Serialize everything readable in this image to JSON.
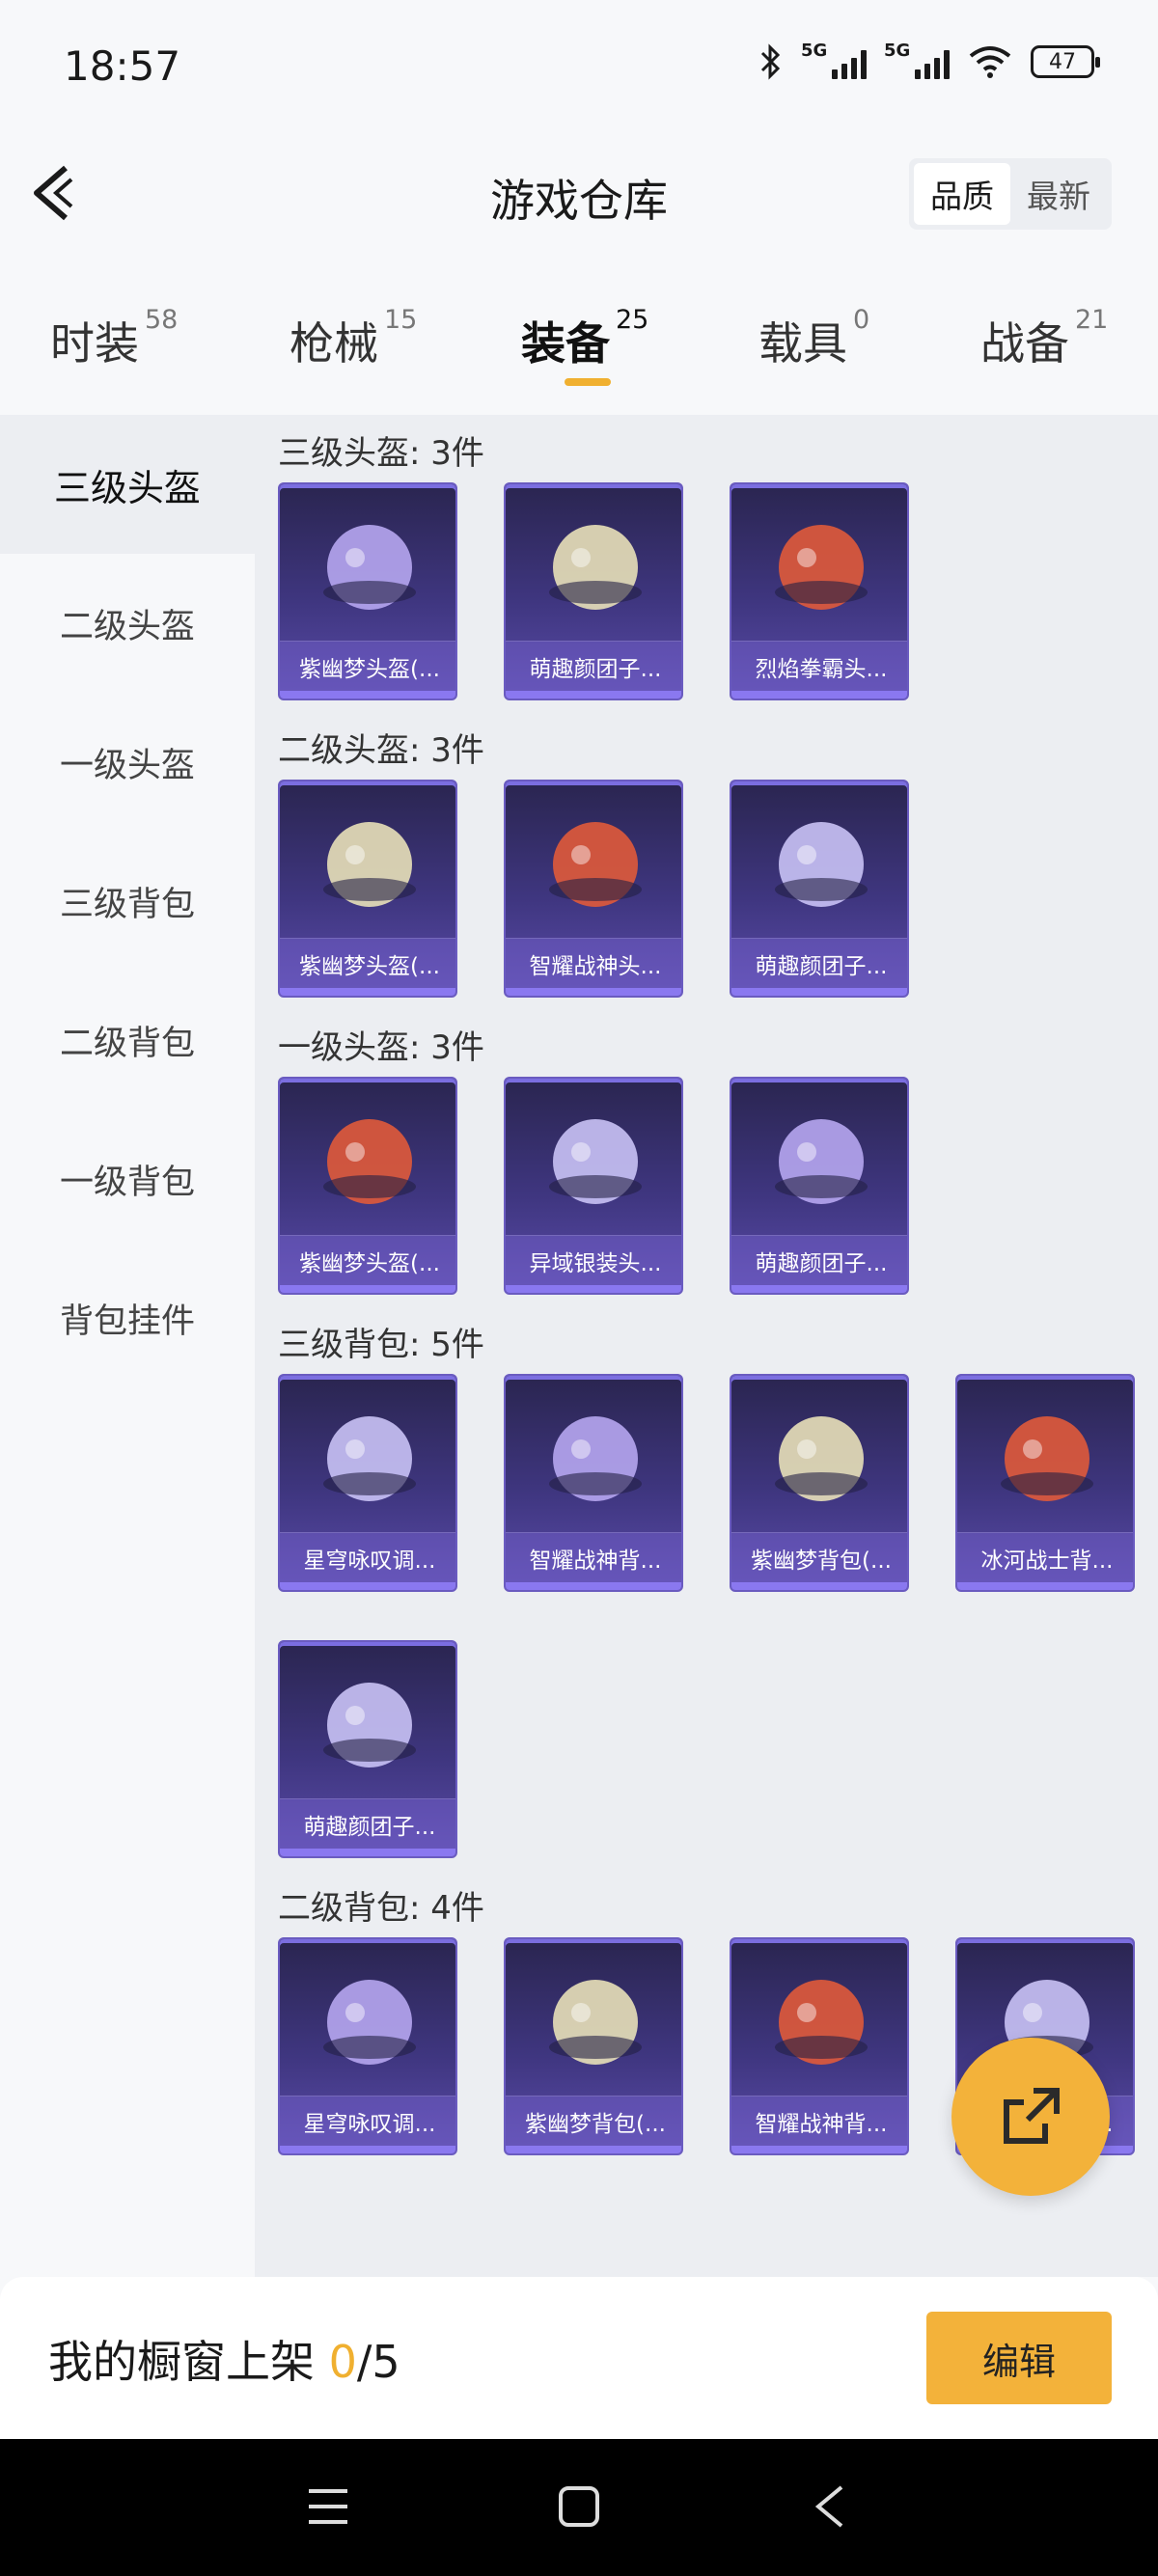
{
  "status": {
    "time": "18:57",
    "network1": "5G",
    "network2": "5G",
    "battery": "47"
  },
  "header": {
    "title": "游戏仓库",
    "sort_options": [
      "品质",
      "最新"
    ],
    "sort_active": "品质"
  },
  "tabs": [
    {
      "label": "时装",
      "count": "58"
    },
    {
      "label": "枪械",
      "count": "15"
    },
    {
      "label": "装备",
      "count": "25"
    },
    {
      "label": "载具",
      "count": "0"
    },
    {
      "label": "战备",
      "count": "21"
    }
  ],
  "active_tab": "装备",
  "sidebar": {
    "items": [
      "三级头盔",
      "二级头盔",
      "一级头盔",
      "三级背包",
      "二级背包",
      "一级背包",
      "背包挂件"
    ],
    "active": "三级头盔"
  },
  "sections": [
    {
      "title": "三级头盔: 3件",
      "items": [
        "紫幽梦头盔(...",
        "萌趣颜团子...",
        "烈焰拳霸头..."
      ]
    },
    {
      "title": "二级头盔: 3件",
      "items": [
        "紫幽梦头盔(...",
        "智耀战神头...",
        "萌趣颜团子..."
      ]
    },
    {
      "title": "一级头盔: 3件",
      "items": [
        "紫幽梦头盔(...",
        "异域银装头...",
        "萌趣颜团子..."
      ]
    },
    {
      "title": "三级背包: 5件",
      "items": [
        "星穹咏叹调...",
        "智耀战神背...",
        "紫幽梦背包(...",
        "冰河战士背...",
        "萌趣颜团子..."
      ]
    },
    {
      "title": "二级背包: 4件",
      "items": [
        "星穹咏叹调...",
        "紫幽梦背包(...",
        "智耀战神背...",
        "萌趣颜团子..."
      ]
    }
  ],
  "showcase": {
    "label": "我的橱窗上架",
    "current": "0",
    "total": "/5",
    "edit_label": "编辑"
  },
  "icons": {
    "back": "chevron-left-icon",
    "share": "share-external-icon"
  },
  "colors": {
    "accent": "#f3b23a",
    "card": "#3f3680"
  }
}
